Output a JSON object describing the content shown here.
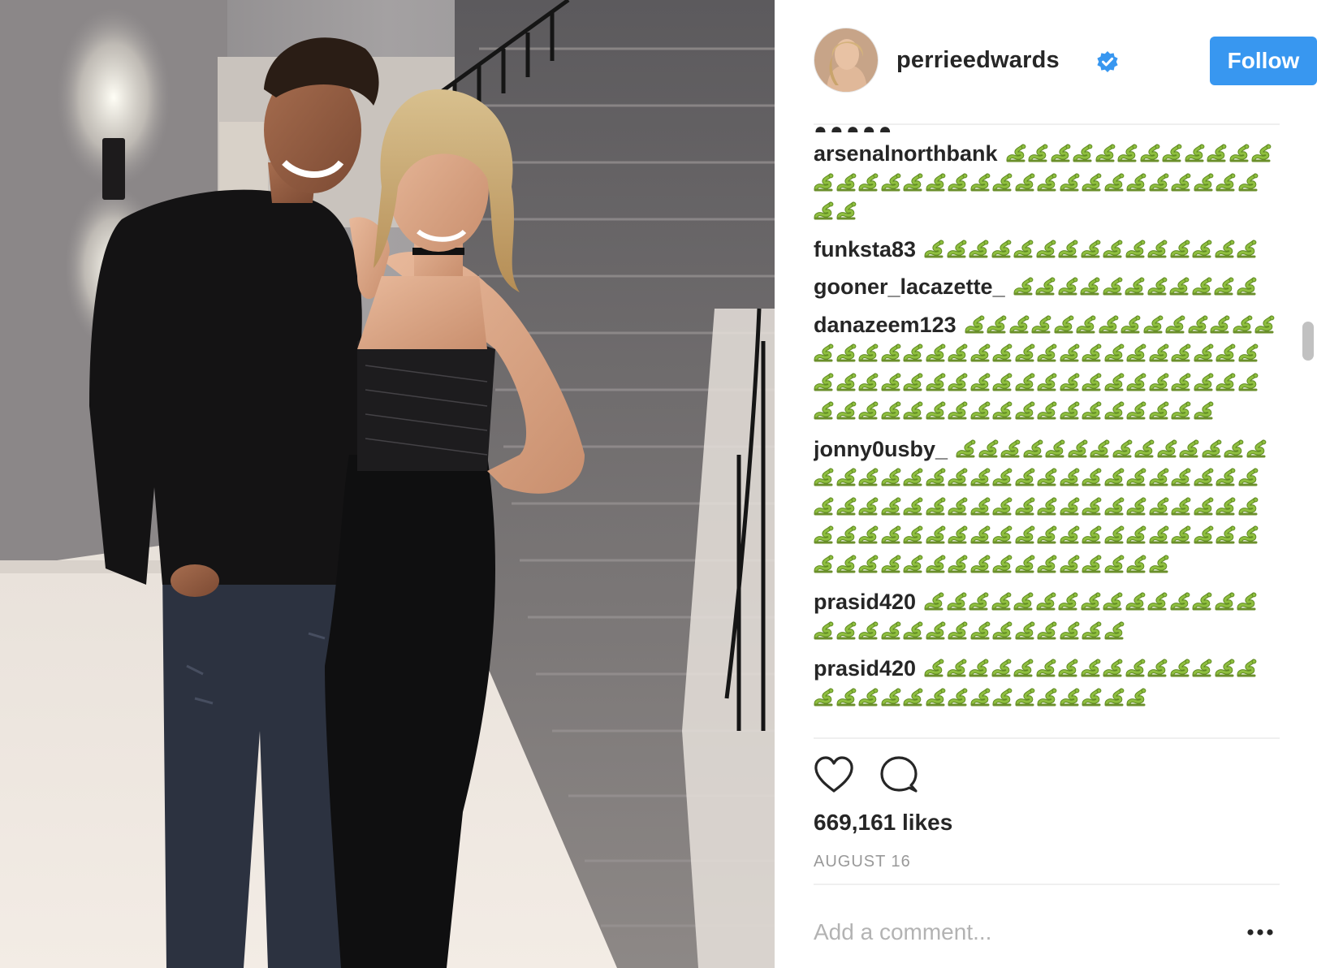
{
  "post": {
    "username": "perrieedwards",
    "follow_label": "Follow",
    "likes": "669,161 likes",
    "date": "AUGUST 16",
    "add_comment_placeholder": "Add a comment..."
  },
  "comments": [
    {
      "user": "arsenalnorthbank",
      "snakes": 34
    },
    {
      "user": "funksta83",
      "snakes": 15
    },
    {
      "user": "gooner_lacazette_",
      "snakes": 11
    },
    {
      "user": "danazeem123",
      "snakes": 72
    },
    {
      "user": "jonny0usby_",
      "snakes": 90
    },
    {
      "user": "prasid420",
      "snakes": 29
    },
    {
      "user": "prasid420",
      "snakes": 30
    }
  ],
  "emoji": "🐍",
  "colors": {
    "follow_button": "#3897f0",
    "verified_badge": "#3897f0",
    "snake_green": "#8fbf3f",
    "muted_text": "#999999"
  },
  "icons": [
    "verified-badge-icon",
    "heart-icon",
    "comment-bubble-icon",
    "more-options-icon",
    "snake-emoji-icon"
  ]
}
